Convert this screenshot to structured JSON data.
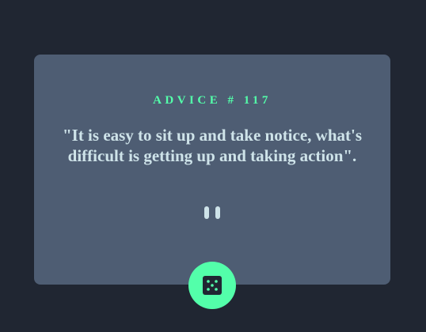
{
  "advice": {
    "label": "ADVICE # 117",
    "quote": "\"It is easy to sit up and take notice, what's difficult is getting up and taking action\"."
  },
  "icons": {
    "divider": "pause-divider-icon",
    "generate": "dice-icon"
  },
  "colors": {
    "background": "#202632",
    "card": "#4e5d73",
    "accent": "#53ffaa",
    "text": "#cee3e9"
  }
}
